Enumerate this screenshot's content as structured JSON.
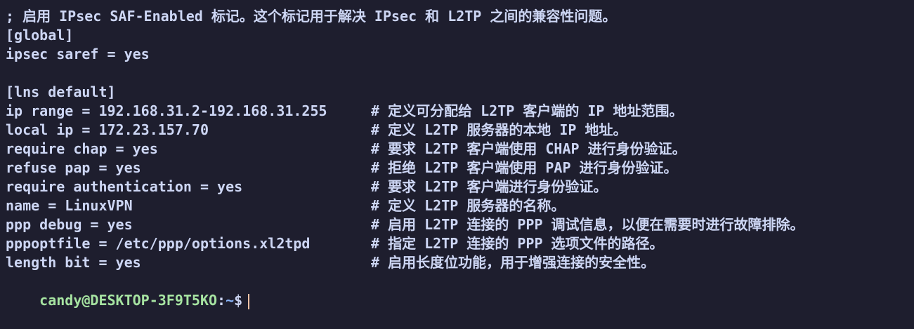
{
  "terminal": {
    "lines": [
      {
        "text": "; 启用 IPsec SAF-Enabled 标记。这个标记用于解决 IPsec 和 L2TP 之间的兼容性问题。"
      },
      {
        "text": "[global]"
      },
      {
        "text": "ipsec saref = yes"
      },
      {
        "text": ""
      },
      {
        "text": "[lns default]"
      },
      {
        "code": "ip range = 192.168.31.2-192.168.31.255",
        "comment": "# 定义可分配给 L2TP 客户端的 IP 地址范围。"
      },
      {
        "code": "local ip = 172.23.157.70",
        "comment": "# 定义 L2TP 服务器的本地 IP 地址。"
      },
      {
        "code": "require chap = yes",
        "comment": "# 要求 L2TP 客户端使用 CHAP 进行身份验证。"
      },
      {
        "code": "refuse pap = yes",
        "comment": "# 拒绝 L2TP 客户端使用 PAP 进行身份验证。"
      },
      {
        "code": "require authentication = yes",
        "comment": "# 要求 L2TP 客户端进行身份验证。"
      },
      {
        "code": "name = LinuxVPN",
        "comment": "# 定义 L2TP 服务器的名称。"
      },
      {
        "code": "ppp debug = yes",
        "comment": "# 启用 L2TP 连接的 PPP 调试信息，以便在需要时进行故障排除。"
      },
      {
        "code": "pppoptfile = /etc/ppp/options.xl2tpd",
        "comment": "# 指定 L2TP 连接的 PPP 选项文件的路径。"
      },
      {
        "code": "length bit = yes",
        "comment": "# 启用长度位功能，用于增强连接的安全性。"
      }
    ],
    "prompt": {
      "user_host": "candy@DESKTOP-3F9T5KO",
      "colon": ":",
      "path": "~",
      "dollar": "$"
    }
  },
  "colors": {
    "background": "#1e1e2e",
    "foreground": "#cdd6f4",
    "prompt_user": "#a6e3a1",
    "prompt_path": "#89b4fa",
    "cursor": "#f5c2a6"
  }
}
